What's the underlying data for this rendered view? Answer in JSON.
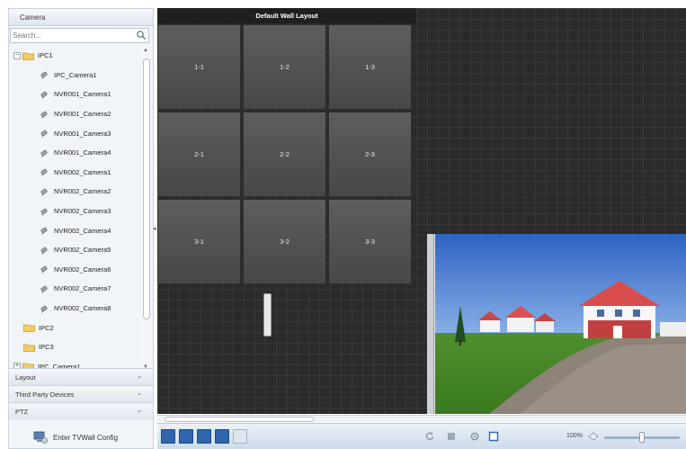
{
  "sidebar": {
    "header": "Camera",
    "search_placeholder": "Search...",
    "tree": [
      {
        "label": "IPC1",
        "type": "group",
        "expanded": true
      },
      {
        "label": "IPC_Camera1",
        "type": "camera"
      },
      {
        "label": "NVR001_Camera1",
        "type": "camera"
      },
      {
        "label": "NVR001_Camera2",
        "type": "camera"
      },
      {
        "label": "NVR001_Camera3",
        "type": "camera"
      },
      {
        "label": "NVR001_Camera4",
        "type": "camera"
      },
      {
        "label": "NVR002_Camera1",
        "type": "camera"
      },
      {
        "label": "NVR002_Camera2",
        "type": "camera"
      },
      {
        "label": "NVR002_Camera3",
        "type": "camera"
      },
      {
        "label": "NVR002_Camera4",
        "type": "camera"
      },
      {
        "label": "NVR002_Camera5",
        "type": "camera"
      },
      {
        "label": "NVR002_Camera6",
        "type": "camera"
      },
      {
        "label": "NVR002_Camera7",
        "type": "camera"
      },
      {
        "label": "NVR002_Camera8",
        "type": "camera"
      },
      {
        "label": "IPC2",
        "type": "group"
      },
      {
        "label": "IPC3",
        "type": "group"
      },
      {
        "label": "IPC_Camera1",
        "type": "group",
        "expanded": false
      }
    ],
    "sections": [
      "Layout",
      "Third Party Devices",
      "PTZ"
    ],
    "enter_config": "Enter TVWall Config"
  },
  "wall": {
    "title": "Default Wall Layout",
    "cells": [
      "1-1",
      "1-2",
      "1-3",
      "2-1",
      "2-2",
      "2-3",
      "3-1",
      "3-2",
      "3-3"
    ]
  },
  "toolbar": {
    "zoom_label": "100%",
    "zoom_level": 0.5
  },
  "colors": {
    "accent": "#2f66ad",
    "canvas": "#2b2b2b",
    "cell": "#555555"
  }
}
